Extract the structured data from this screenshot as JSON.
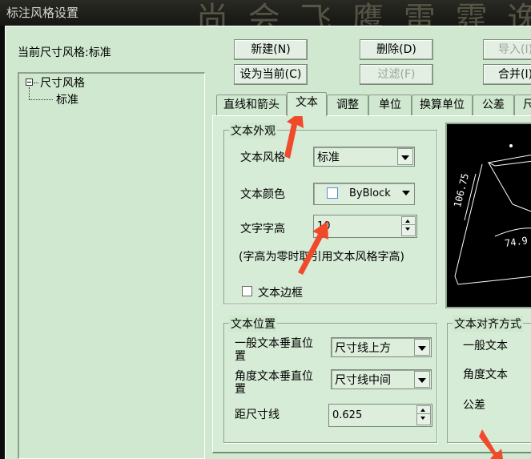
{
  "window": {
    "title": "标注风格设置",
    "background_text": "尚 会 飞 鹰 雷 霆 逸"
  },
  "current_style": {
    "label": "当前尺寸风格:",
    "value": "标准"
  },
  "tree": {
    "root": "尺寸风格",
    "child": "标准"
  },
  "buttons": {
    "new": "新建(N)",
    "delete": "删除(D)",
    "import": "导入(I)",
    "set_current": "设为当前(C)",
    "filter": "过滤(F)",
    "merge": "合并(I)"
  },
  "tabs": [
    "直线和箭头",
    "文本",
    "调整",
    "单位",
    "换算单位",
    "公差",
    "尺"
  ],
  "active_tab": "文本",
  "text_appearance": {
    "group_title": "文本外观",
    "style_label": "文本风格",
    "style_value": "标准",
    "color_label": "文本颜色",
    "color_value": "ByBlock",
    "height_label": "文字字高",
    "height_value": "10",
    "note": "(字高为零时取引用文本风格字高)",
    "border_label": "文本边框",
    "border_checked": false
  },
  "text_position": {
    "group_title": "文本位置",
    "vertical_label_1": "一般文本垂直位",
    "vertical_label_2": "置",
    "vertical_value": "尺寸线上方",
    "angle_label_1": "角度文本垂直位",
    "angle_label_2": "置",
    "angle_value": "尺寸线中间",
    "offset_label": "距尺寸线",
    "offset_value": "0.625"
  },
  "text_alignment": {
    "group_title": "文本对齐方式",
    "general": "一般文本",
    "angle": "角度文本",
    "tolerance": "公差"
  },
  "preview": {
    "dim_text_1": "106.75",
    "dim_text_2": "74.9"
  },
  "colors": {
    "dialog_bg": "#cfe8cf",
    "preview_bg": "#000000",
    "annotation_arrow": "#f04a2a"
  }
}
